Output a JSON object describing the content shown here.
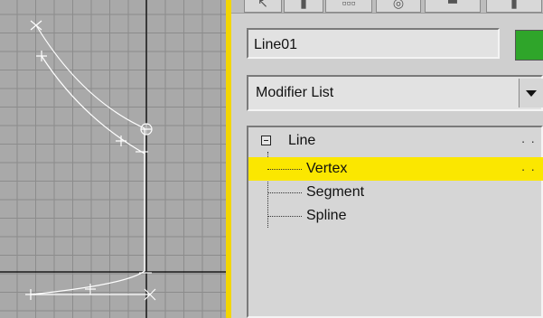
{
  "object_name": "Line01",
  "object_color": "#2fa52a",
  "modifier_list": {
    "label": "Modifier List"
  },
  "stack": {
    "root": {
      "label": "Line",
      "icon": "collapse-minus-icon"
    },
    "items": [
      {
        "label": "Vertex",
        "selected": true
      },
      {
        "label": "Segment",
        "selected": false
      },
      {
        "label": "Spline",
        "selected": false
      }
    ],
    "dots": "· ·"
  },
  "viewport": {
    "background": "#a9a9a9",
    "grid_color": "#8c8c8c",
    "active_border": "#f3d600"
  }
}
